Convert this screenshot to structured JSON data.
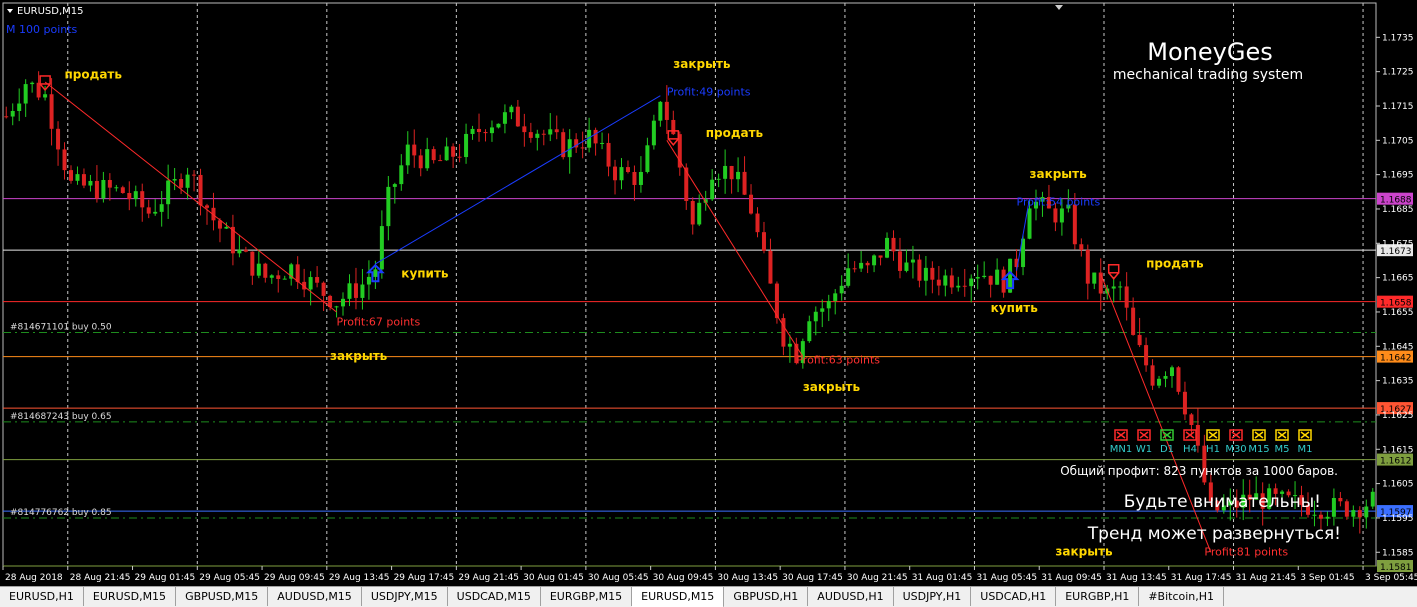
{
  "window": {
    "title": "EURUSD,M15",
    "corner_label": "M 100 points"
  },
  "logo": {
    "title": "MoneyGes",
    "subtitle": "mechanical trading system"
  },
  "colors": {
    "background": "#000000",
    "bull": "#22cc22",
    "bear": "#dd2222",
    "grid": "#c8c8c8",
    "signal_text": "#ffd700",
    "profit_text": "#ff3030",
    "blue": "#1a3cff"
  },
  "chart_data": {
    "type": "candlestick",
    "symbol": "EURUSD",
    "timeframe": "M15",
    "ylim": [
      1.1581,
      1.1745
    ],
    "y_ticks": [
      1.1585,
      1.1595,
      1.1605,
      1.1615,
      1.1625,
      1.1635,
      1.1645,
      1.1655,
      1.1665,
      1.1675,
      1.1685,
      1.1695,
      1.1705,
      1.1715,
      1.1725,
      1.1735
    ],
    "x_tick_labels": [
      "28 Aug 2018",
      "28 Aug 21:45",
      "29 Aug 01:45",
      "29 Aug 05:45",
      "29 Aug 09:45",
      "29 Aug 13:45",
      "29 Aug 17:45",
      "29 Aug 21:45",
      "30 Aug 01:45",
      "30 Aug 05:45",
      "30 Aug 09:45",
      "30 Aug 13:45",
      "30 Aug 17:45",
      "30 Aug 21:45",
      "31 Aug 01:45",
      "31 Aug 05:45",
      "31 Aug 09:45",
      "31 Aug 13:45",
      "31 Aug 17:45",
      "31 Aug 21:45",
      "3 Sep 01:45",
      "3 Sep 05:45"
    ],
    "price_path": [
      [
        0,
        1.1712
      ],
      [
        3,
        1.1722
      ],
      [
        6,
        1.1718
      ],
      [
        10,
        1.1692
      ],
      [
        14,
        1.1691
      ],
      [
        18,
        1.169
      ],
      [
        22,
        1.1684
      ],
      [
        26,
        1.1692
      ],
      [
        28,
        1.1697
      ],
      [
        32,
        1.1682
      ],
      [
        36,
        1.1672
      ],
      [
        40,
        1.1665
      ],
      [
        44,
        1.1668
      ],
      [
        48,
        1.1662
      ],
      [
        51,
        1.1658
      ],
      [
        55,
        1.1663
      ],
      [
        57,
        1.1668
      ],
      [
        59,
        1.1688
      ],
      [
        62,
        1.1702
      ],
      [
        66,
        1.1698
      ],
      [
        70,
        1.1702
      ],
      [
        74,
        1.171
      ],
      [
        78,
        1.1712
      ],
      [
        82,
        1.1708
      ],
      [
        86,
        1.1703
      ],
      [
        90,
        1.1706
      ],
      [
        94,
        1.1696
      ],
      [
        98,
        1.1694
      ],
      [
        100,
        1.1708
      ],
      [
        101,
        1.1718
      ],
      [
        103,
        1.1706
      ],
      [
        106,
        1.168
      ],
      [
        109,
        1.1697
      ],
      [
        112,
        1.1696
      ],
      [
        115,
        1.1685
      ],
      [
        118,
        1.1662
      ],
      [
        120,
        1.1648
      ],
      [
        122,
        1.1643
      ],
      [
        124,
        1.1655
      ],
      [
        127,
        1.1657
      ],
      [
        130,
        1.1668
      ],
      [
        133,
        1.1667
      ],
      [
        136,
        1.1675
      ],
      [
        139,
        1.1668
      ],
      [
        142,
        1.1665
      ],
      [
        146,
        1.1665
      ],
      [
        150,
        1.1667
      ],
      [
        154,
        1.1664
      ],
      [
        156,
        1.167
      ],
      [
        158,
        1.1688
      ],
      [
        161,
        1.1684
      ],
      [
        164,
        1.1683
      ],
      [
        167,
        1.1665
      ],
      [
        170,
        1.166
      ],
      [
        172,
        1.1662
      ],
      [
        174,
        1.1647
      ],
      [
        177,
        1.1636
      ],
      [
        180,
        1.164
      ],
      [
        183,
        1.1622
      ],
      [
        186,
        1.1597
      ],
      [
        189,
        1.1598
      ],
      [
        192,
        1.1601
      ],
      [
        196,
        1.16
      ],
      [
        200,
        1.1599
      ],
      [
        204,
        1.1598
      ],
      [
        208,
        1.1598
      ],
      [
        211,
        1.16
      ]
    ],
    "horizontal_levels": [
      {
        "price": 1.1688,
        "color": "#cc44cc",
        "label": "1.1688"
      },
      {
        "price": 1.1673,
        "color": "#e8e8e8",
        "label": "1.1673"
      },
      {
        "price": 1.1658,
        "color": "#ff2a2a",
        "label": "1.1658"
      },
      {
        "price": 1.1642,
        "color": "#ff8c1a",
        "label": "1.1642"
      },
      {
        "price": 1.1627,
        "color": "#ff5533",
        "label": "1.1627"
      },
      {
        "price": 1.1612,
        "color": "#7f9f3f",
        "label": "1.1612"
      },
      {
        "price": 1.1597,
        "color": "#3b6fff",
        "label": "1.1597"
      },
      {
        "price": 1.1581,
        "color": "#7f9f3f",
        "label": "1.1581"
      }
    ],
    "order_lines": [
      {
        "price": 1.1649,
        "label": "#814671101 buy 0.50"
      },
      {
        "price": 1.1623,
        "label": "#814687243 buy 0.65"
      },
      {
        "price": 1.1595,
        "label": "#814776762 buy 0.85"
      }
    ],
    "trade_lines": [
      {
        "bars": [
          6,
          51
        ],
        "prices": [
          1.1722,
          1.1655
        ],
        "color": "#ff2a2a"
      },
      {
        "bars": [
          57,
          101
        ],
        "prices": [
          1.1669,
          1.1718
        ],
        "color": "#1a3cff"
      },
      {
        "bars": [
          102,
          123
        ],
        "prices": [
          1.1705,
          1.1642
        ],
        "color": "#ff2a2a"
      },
      {
        "bars": [
          156,
          158
        ],
        "prices": [
          1.1667,
          1.1688
        ],
        "color": "#1a3cff"
      },
      {
        "bars": [
          169,
          186
        ],
        "prices": [
          1.1666,
          1.1585
        ],
        "color": "#ff2a2a"
      }
    ],
    "annotations": [
      {
        "text": "продать",
        "bar": 9,
        "price": 1.1723,
        "style": "signal"
      },
      {
        "text": "Profit:67 points",
        "bar": 51,
        "price": 1.1651,
        "style": "profit"
      },
      {
        "text": "закрыть",
        "bar": 50,
        "price": 1.1641,
        "style": "signal"
      },
      {
        "text": "купить",
        "bar": 61,
        "price": 1.1665,
        "style": "signal"
      },
      {
        "text": "закрыть",
        "bar": 103,
        "price": 1.1726,
        "style": "signal"
      },
      {
        "text": "Profit:49 points",
        "bar": 102,
        "price": 1.1718,
        "style": "profit_blue"
      },
      {
        "text": "продать",
        "bar": 108,
        "price": 1.1706,
        "style": "signal"
      },
      {
        "text": "Profit:63 points",
        "bar": 122,
        "price": 1.164,
        "style": "profit"
      },
      {
        "text": "закрыть",
        "bar": 123,
        "price": 1.1632,
        "style": "signal"
      },
      {
        "text": "закрыть",
        "bar": 158,
        "price": 1.1694,
        "style": "signal"
      },
      {
        "text": "Profit:54 points",
        "bar": 156,
        "price": 1.1686,
        "style": "profit_blue"
      },
      {
        "text": "купить",
        "bar": 152,
        "price": 1.1655,
        "style": "signal"
      },
      {
        "text": "продать",
        "bar": 176,
        "price": 1.1668,
        "style": "signal"
      },
      {
        "text": "закрыть",
        "bar": 162,
        "price": 1.1584,
        "style": "signal"
      },
      {
        "text": "Profit:81 points",
        "bar": 185,
        "price": 1.1584,
        "style": "profit"
      }
    ],
    "markers": [
      {
        "kind": "down",
        "bar": 6,
        "price": 1.1722
      },
      {
        "kind": "up",
        "bar": 57,
        "price": 1.1666
      },
      {
        "kind": "down",
        "bar": 103,
        "price": 1.1706
      },
      {
        "kind": "up",
        "bar": 155,
        "price": 1.1664
      },
      {
        "kind": "down",
        "bar": 171,
        "price": 1.1667
      }
    ],
    "signal_panel": [
      {
        "label": "MN1",
        "state": "sell"
      },
      {
        "label": "W1",
        "state": "sell"
      },
      {
        "label": "D1",
        "state": "buy"
      },
      {
        "label": "H4",
        "state": "sell"
      },
      {
        "label": "H1",
        "state": "flat"
      },
      {
        "label": "M30",
        "state": "sell"
      },
      {
        "label": "M15",
        "state": "flat"
      },
      {
        "label": "M5",
        "state": "flat"
      },
      {
        "label": "M1",
        "state": "flat"
      }
    ],
    "summary_text": "Общий профит: 823 пунктов за 1000 баров.",
    "warning_line1": "Будьте внимательны!",
    "warning_line2": "Тренд может развернуться!"
  },
  "tabs": [
    {
      "label": "EURUSD,H1",
      "active": false
    },
    {
      "label": "EURUSD,M15",
      "active": false
    },
    {
      "label": "GBPUSD,M15",
      "active": false
    },
    {
      "label": "AUDUSD,M15",
      "active": false
    },
    {
      "label": "USDJPY,M15",
      "active": false
    },
    {
      "label": "USDCAD,M15",
      "active": false
    },
    {
      "label": "EURGBP,M15",
      "active": false
    },
    {
      "label": "EURUSD,M15",
      "active": true
    },
    {
      "label": "GBPUSD,H1",
      "active": false
    },
    {
      "label": "AUDUSD,H1",
      "active": false
    },
    {
      "label": "USDJPY,H1",
      "active": false
    },
    {
      "label": "USDCAD,H1",
      "active": false
    },
    {
      "label": "EURGBP,H1",
      "active": false
    },
    {
      "label": "#Bitcoin,H1",
      "active": false
    }
  ]
}
